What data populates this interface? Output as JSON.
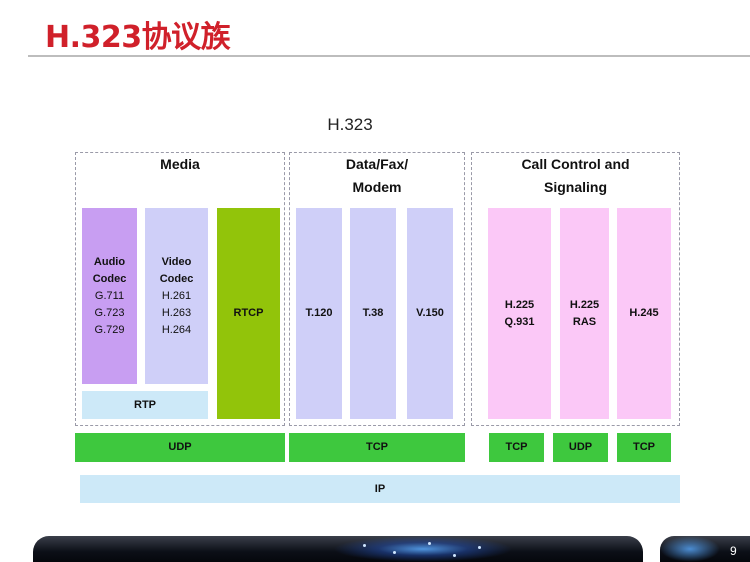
{
  "slide": {
    "title": "H.323协议族",
    "page_number": "9"
  },
  "diagram": {
    "title": "H.323",
    "groups": {
      "media": "Media",
      "data_fax_line1": "Data/Fax/",
      "data_fax_line2": "Modem",
      "call_control_line1": "Call Control and",
      "call_control_line2": "Signaling"
    },
    "audio_codec": {
      "name_line1": "Audio",
      "name_line2": "Codec",
      "items": [
        "G.711",
        "G.723",
        "G.729"
      ]
    },
    "video_codec": {
      "name_line1": "Video",
      "name_line2": "Codec",
      "items": [
        "H.261",
        "H.263",
        "H.264"
      ]
    },
    "rtp": "RTP",
    "rtcp": "RTCP",
    "t120": "T.120",
    "t38": "T.38",
    "v150": "V.150",
    "h225_q931_line1": "H.225",
    "h225_q931_line2": "Q.931",
    "h225_ras_line1": "H.225",
    "h225_ras_line2": "RAS",
    "h245": "H.245",
    "transport": {
      "udp_media": "UDP",
      "tcp_data": "TCP",
      "tcp_q931": "TCP",
      "udp_ras": "UDP",
      "tcp_h245": "TCP"
    },
    "ip": "IP"
  },
  "colors": {
    "title_red": "#d0202a",
    "codec_purple": "#c89ef2",
    "lavender": "#cfcff8",
    "rtcp_green": "#92c40a",
    "light_blue": "#cde9f8",
    "pink": "#fbc8f7",
    "transport_green": "#3ec83e"
  }
}
